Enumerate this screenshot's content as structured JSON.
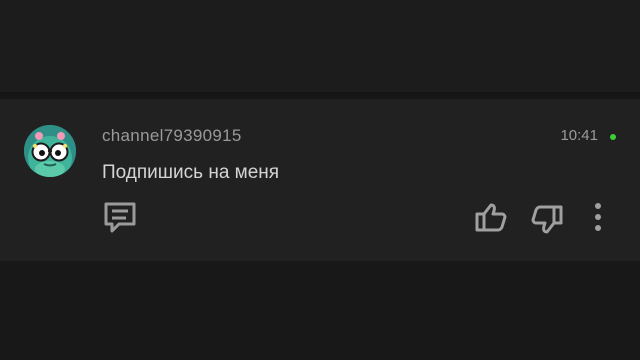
{
  "comment": {
    "author": "channel79390915",
    "text": "Подпишись на меня",
    "time": "10:41",
    "status_color": "#3ad134",
    "avatar_icon": "frog-avatar-icon"
  },
  "actions": {
    "reply_icon": "comment-icon",
    "like_icon": "thumbs-up-icon",
    "dislike_icon": "thumbs-down-icon",
    "more_icon": "more-vertical-icon"
  }
}
